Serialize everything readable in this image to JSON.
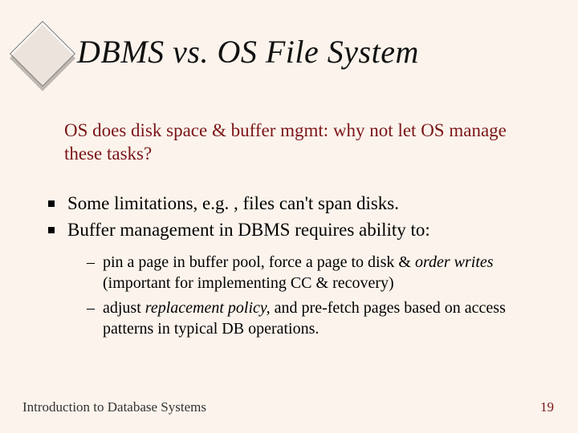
{
  "title": "DBMS vs. OS File System",
  "subtitle": "OS does disk space & buffer mgmt: why not let OS manage these tasks?",
  "bullets": [
    "Some limitations, e.g. , files can't span disks.",
    "Buffer management in DBMS requires ability to:"
  ],
  "subbullets": [
    {
      "pre": "pin a page in buffer pool, force a page to disk & ",
      "ital": "order writes",
      "post": " (important for implementing CC & recovery)"
    },
    {
      "pre": "adjust ",
      "ital": "replacement policy,",
      "post": " and pre-fetch pages based on access patterns in typical DB operations."
    }
  ],
  "footer_left": "Introduction to Database Systems",
  "footer_right": "19"
}
